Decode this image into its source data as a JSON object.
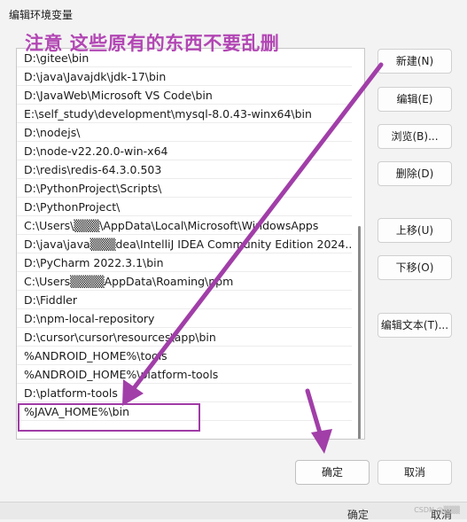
{
  "window": {
    "title": "编辑环境变量"
  },
  "annotation": {
    "text": "注意 这些原有的东西不要乱删"
  },
  "path_entries": [
    "D:\\gitee\\bin",
    "D:\\java\\Javajdk\\jdk-17\\bin",
    "D:\\JavaWeb\\Microsoft VS Code\\bin",
    "E:\\self_study\\development\\mysql-8.0.43-winx64\\bin",
    "D:\\nodejs\\",
    "D:\\node-v22.20.0-win-x64",
    "D:\\redis\\redis-64.3.0.503",
    "D:\\PythonProject\\Scripts\\",
    "D:\\PythonProject\\",
    "C:\\Users\\▒▒▒\\AppData\\Local\\Microsoft\\WindowsApps",
    "D:\\java\\java▒▒▒dea\\IntelliJ IDEA Community Edition 2024....",
    "D:\\PyCharm 2022.3.1\\bin",
    "C:\\Users▒▒▒▒AppData\\Roaming\\npm",
    "D:\\Fiddler",
    "D:\\npm-local-repository",
    "D:\\cursor\\cursor\\resources\\app\\bin",
    "%ANDROID_HOME%\\tools",
    "%ANDROID_HOME%\\platform-tools",
    "D:\\platform-tools",
    "%JAVA_HOME%\\bin"
  ],
  "buttons": {
    "new": "新建(N)",
    "edit": "编辑(E)",
    "browse": "浏览(B)...",
    "delete": "删除(D)",
    "move_up": "上移(U)",
    "move_down": "下移(O)",
    "edit_text": "编辑文本(T)...",
    "ok": "确定",
    "cancel": "取消"
  },
  "bottom_strip": {
    "ok": "确定",
    "cancel": "取消"
  },
  "watermark": "CSDN @▒▒▒",
  "colors": {
    "annotation": "#b246b4",
    "arrow": "#a13ea8"
  }
}
